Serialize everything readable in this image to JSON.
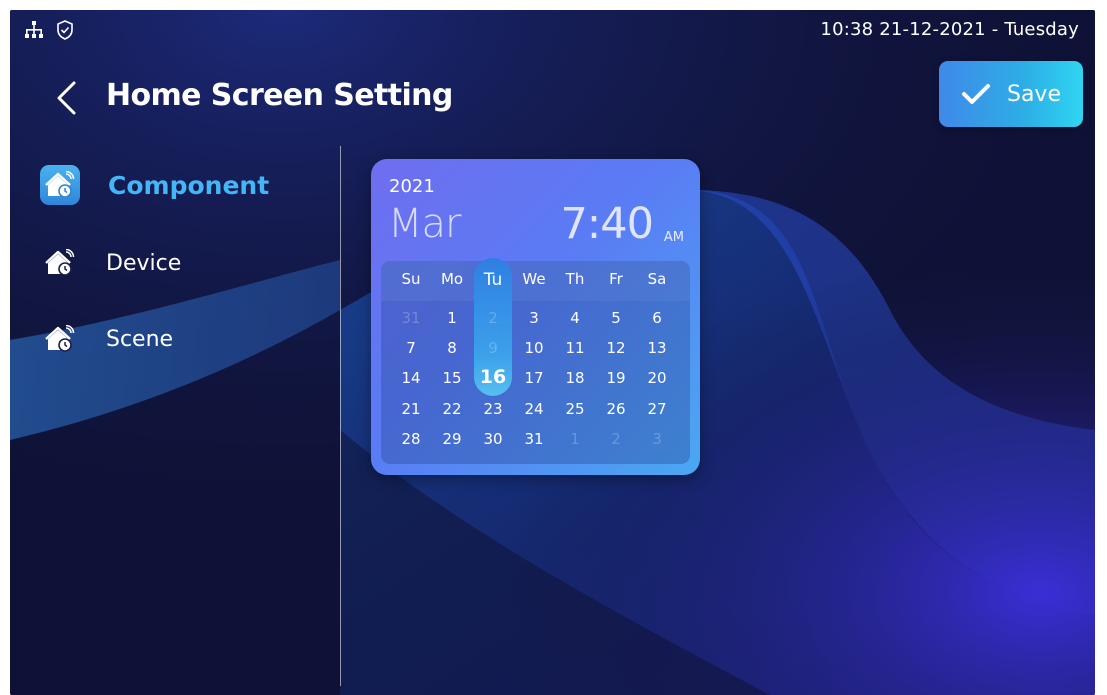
{
  "status_bar": {
    "icons": [
      "network-icon",
      "shield-check-icon"
    ],
    "datetime": "10:38  21-12-2021 - Tuesday"
  },
  "header": {
    "title": "Home Screen Setting",
    "save_label": "Save"
  },
  "sidebar": {
    "items": [
      {
        "label": "Component",
        "icon": "home-widget-icon",
        "active": true
      },
      {
        "label": "Device",
        "icon": "home-widget-icon",
        "active": false
      },
      {
        "label": "Scene",
        "icon": "home-widget-icon",
        "active": false
      }
    ]
  },
  "widget": {
    "year": "2021",
    "month": "Mar",
    "time": "7:40",
    "ampm": "AM",
    "weekdays": [
      "Su",
      "Mo",
      "Tu",
      "We",
      "Th",
      "Fr",
      "Sa"
    ],
    "weeks": [
      [
        "31",
        "1",
        "2",
        "3",
        "4",
        "5",
        "6"
      ],
      [
        "7",
        "8",
        "9",
        "10",
        "11",
        "12",
        "13"
      ],
      [
        "14",
        "15",
        "16",
        "17",
        "18",
        "19",
        "20"
      ],
      [
        "21",
        "22",
        "23",
        "24",
        "25",
        "26",
        "27"
      ],
      [
        "28",
        "29",
        "30",
        "31",
        "1",
        "2",
        "3"
      ]
    ],
    "dimmed": [
      [
        0,
        0
      ],
      [
        0,
        2
      ],
      [
        1,
        2
      ],
      [
        4,
        4
      ],
      [
        4,
        5
      ],
      [
        4,
        6
      ]
    ],
    "today": [
      2,
      2
    ]
  },
  "colors": {
    "accent": "#45b6f5",
    "save_button": "#2eaee6",
    "background": "#101339"
  }
}
